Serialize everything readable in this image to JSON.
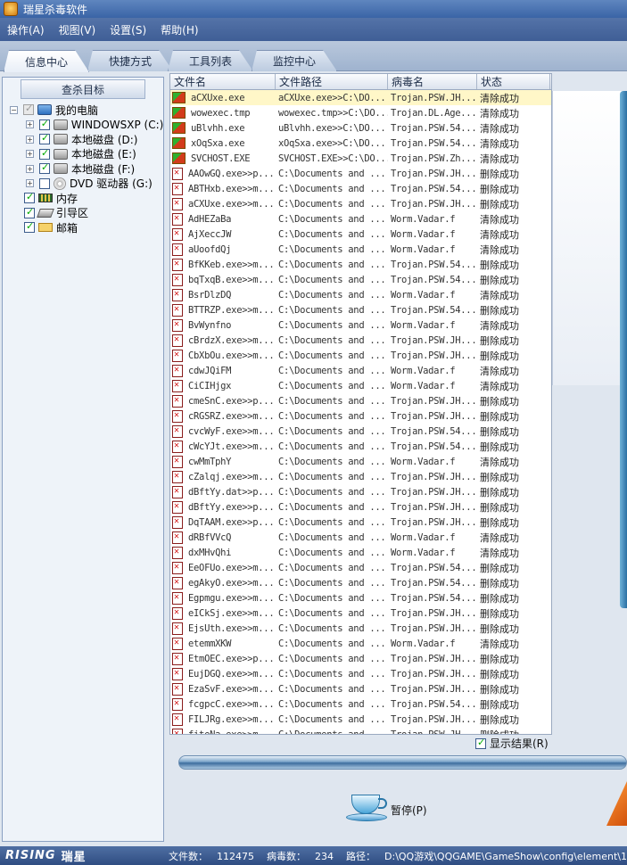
{
  "window": {
    "title": "瑞星杀毒软件"
  },
  "menu": [
    "操作(A)",
    "视图(V)",
    "设置(S)",
    "帮助(H)"
  ],
  "tabs": [
    "信息中心",
    "快捷方式",
    "工具列表",
    "监控中心"
  ],
  "sidebar": {
    "title": "查杀目标",
    "tree": [
      {
        "label": "我的电脑",
        "checked": true,
        "icon": "computer-icon"
      },
      {
        "label": "WINDOWSXP  (C:)",
        "checked": true,
        "icon": "hard-disk-icon"
      },
      {
        "label": "本地磁盘  (D:)",
        "checked": true,
        "icon": "hard-disk-icon"
      },
      {
        "label": "本地磁盘  (E:)",
        "checked": true,
        "icon": "hard-disk-icon"
      },
      {
        "label": "本地磁盘  (F:)",
        "checked": true,
        "icon": "hard-disk-icon"
      },
      {
        "label": "DVD 驱动器  (G:)",
        "checked": false,
        "icon": "dvd-icon"
      },
      {
        "label": "内存",
        "checked": true,
        "icon": "memory-icon"
      },
      {
        "label": "引导区",
        "checked": true,
        "icon": "boot-sector-icon"
      },
      {
        "label": "邮箱",
        "checked": true,
        "icon": "mail-icon"
      }
    ]
  },
  "list": {
    "columns": [
      "文件名",
      "文件路径",
      "病毒名",
      "状态"
    ],
    "rows": [
      [
        "aCXUxe.exe",
        "aCXUxe.exe>>C:\\DO...",
        "Trojan.PSW.JH...",
        "清除成功"
      ],
      [
        "wowexec.tmp",
        "wowexec.tmp>>C:\\DO...",
        "Trojan.DL.Age...",
        "清除成功"
      ],
      [
        "uBlvhh.exe",
        "uBlvhh.exe>>C:\\DO...",
        "Trojan.PSW.54...",
        "清除成功"
      ],
      [
        "xOqSxa.exe",
        "xOqSxa.exe>>C:\\DO...",
        "Trojan.PSW.54...",
        "清除成功"
      ],
      [
        "SVCHOST.EXE",
        "SVCHOST.EXE>>C:\\DO...",
        "Trojan.PSW.Zh...",
        "清除成功"
      ],
      [
        "AAOwGQ.exe>>p...",
        "C:\\Documents and ...",
        "Trojan.PSW.JH...",
        "删除成功"
      ],
      [
        "ABTHxb.exe>>m...",
        "C:\\Documents and ...",
        "Trojan.PSW.54...",
        "删除成功"
      ],
      [
        "aCXUxe.exe>>m...",
        "C:\\Documents and ...",
        "Trojan.PSW.JH...",
        "删除成功"
      ],
      [
        "AdHEZaBa",
        "C:\\Documents and ...",
        "Worm.Vadar.f",
        "清除成功"
      ],
      [
        "AjXeccJW",
        "C:\\Documents and ...",
        "Worm.Vadar.f",
        "清除成功"
      ],
      [
        "aUoofdQj",
        "C:\\Documents and ...",
        "Worm.Vadar.f",
        "清除成功"
      ],
      [
        "BfKKeb.exe>>m...",
        "C:\\Documents and ...",
        "Trojan.PSW.54...",
        "删除成功"
      ],
      [
        "bqTxqB.exe>>m...",
        "C:\\Documents and ...",
        "Trojan.PSW.54...",
        "删除成功"
      ],
      [
        "BsrDlzDQ",
        "C:\\Documents and ...",
        "Worm.Vadar.f",
        "清除成功"
      ],
      [
        "BTTRZP.exe>>m...",
        "C:\\Documents and ...",
        "Trojan.PSW.54...",
        "删除成功"
      ],
      [
        "BvWynfno",
        "C:\\Documents and ...",
        "Worm.Vadar.f",
        "清除成功"
      ],
      [
        "cBrdzX.exe>>m...",
        "C:\\Documents and ...",
        "Trojan.PSW.JH...",
        "删除成功"
      ],
      [
        "CbXbOu.exe>>m...",
        "C:\\Documents and ...",
        "Trojan.PSW.JH...",
        "删除成功"
      ],
      [
        "cdwJQiFM",
        "C:\\Documents and ...",
        "Worm.Vadar.f",
        "清除成功"
      ],
      [
        "CiCIHjgx",
        "C:\\Documents and ...",
        "Worm.Vadar.f",
        "清除成功"
      ],
      [
        "cmeSnC.exe>>p...",
        "C:\\Documents and ...",
        "Trojan.PSW.JH...",
        "删除成功"
      ],
      [
        "cRGSRZ.exe>>m...",
        "C:\\Documents and ...",
        "Trojan.PSW.JH...",
        "删除成功"
      ],
      [
        "cvcWyF.exe>>m...",
        "C:\\Documents and ...",
        "Trojan.PSW.54...",
        "删除成功"
      ],
      [
        "cWcYJt.exe>>m...",
        "C:\\Documents and ...",
        "Trojan.PSW.54...",
        "删除成功"
      ],
      [
        "cwMmTphY",
        "C:\\Documents and ...",
        "Worm.Vadar.f",
        "清除成功"
      ],
      [
        "cZalqj.exe>>m...",
        "C:\\Documents and ...",
        "Trojan.PSW.JH...",
        "删除成功"
      ],
      [
        "dBftYy.dat>>p...",
        "C:\\Documents and ...",
        "Trojan.PSW.JH...",
        "删除成功"
      ],
      [
        "dBftYy.exe>>p...",
        "C:\\Documents and ...",
        "Trojan.PSW.JH...",
        "删除成功"
      ],
      [
        "DqTAAM.exe>>p...",
        "C:\\Documents and ...",
        "Trojan.PSW.JH...",
        "删除成功"
      ],
      [
        "dRBfVVcQ",
        "C:\\Documents and ...",
        "Worm.Vadar.f",
        "清除成功"
      ],
      [
        "dxMHvQhi",
        "C:\\Documents and ...",
        "Worm.Vadar.f",
        "清除成功"
      ],
      [
        "EeOFUo.exe>>m...",
        "C:\\Documents and ...",
        "Trojan.PSW.54...",
        "删除成功"
      ],
      [
        "egAkyO.exe>>m...",
        "C:\\Documents and ...",
        "Trojan.PSW.54...",
        "删除成功"
      ],
      [
        "Egpmgu.exe>>m...",
        "C:\\Documents and ...",
        "Trojan.PSW.54...",
        "删除成功"
      ],
      [
        "eICkSj.exe>>m...",
        "C:\\Documents and ...",
        "Trojan.PSW.JH...",
        "删除成功"
      ],
      [
        "EjsUth.exe>>m...",
        "C:\\Documents and ...",
        "Trojan.PSW.JH...",
        "删除成功"
      ],
      [
        "etemmXKW",
        "C:\\Documents and ...",
        "Worm.Vadar.f",
        "清除成功"
      ],
      [
        "EtmOEC.exe>>p...",
        "C:\\Documents and ...",
        "Trojan.PSW.JH...",
        "删除成功"
      ],
      [
        "EujDGQ.exe>>m...",
        "C:\\Documents and ...",
        "Trojan.PSW.JH...",
        "删除成功"
      ],
      [
        "EzaSvF.exe>>m...",
        "C:\\Documents and ...",
        "Trojan.PSW.JH...",
        "删除成功"
      ],
      [
        "fcgpcC.exe>>m...",
        "C:\\Documents and ...",
        "Trojan.PSW.54...",
        "删除成功"
      ],
      [
        "FILJRg.exe>>m...",
        "C:\\Documents and ...",
        "Trojan.PSW.JH...",
        "删除成功"
      ],
      [
        "fiteNa.exe>>m...",
        "C:\\Documents and ...",
        "Trojan.PSW.JH...",
        "删除成功"
      ]
    ]
  },
  "controls": {
    "show_results_label": "显示结果(R)",
    "show_results_checked": true,
    "pause_label": "暂停(P)"
  },
  "status": {
    "logo_en": "RISING",
    "logo_cn": "瑞星",
    "files_label": "文件数：",
    "files_value": "112475",
    "virus_label": "病毒数：",
    "virus_value": "234",
    "path_label": "路径：",
    "path_value": "D:\\QQ游戏\\QQGAME\\GameShow\\config\\element\\1"
  }
}
